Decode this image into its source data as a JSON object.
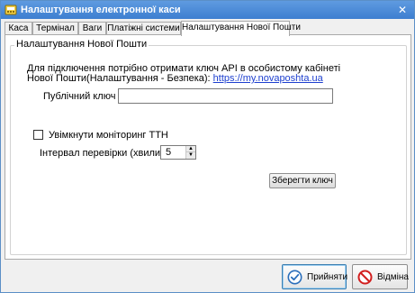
{
  "window": {
    "title": "Налаштування електронної каси",
    "close_glyph": "✕"
  },
  "tabs": [
    {
      "label": "Каса"
    },
    {
      "label": "Термінал"
    },
    {
      "label": "Ваги"
    },
    {
      "label": "Платіжні системи"
    },
    {
      "label": "Налаштування Нової Пошти"
    }
  ],
  "active_tab": "Налаштування Нової Пошти",
  "group": {
    "title": "Налаштування Нової Пошти",
    "info_line1": "Для підключення  потрібно отримати ключ API в особистому кабінеті",
    "info_line2_prefix": "Нової Пошти(Налаштування - Безпека): ",
    "info_link": "https://my.novaposhta.ua",
    "key_label": "Публічний ключ :",
    "key_value": "",
    "monitoring_label": "Увімкнути моніторинг ТТН",
    "monitoring_checked": false,
    "interval_label": "Інтервал перевірки (хвилин):",
    "interval_value": "5",
    "save_key_label": "Зберегти ключ"
  },
  "buttons": {
    "accept_label": "Прийняти",
    "cancel_label": "Відміна"
  },
  "colors": {
    "titlebar": "#3d7ed0",
    "accept_icon": "#2a6ebb",
    "cancel_icon": "#d21f1f",
    "link": "#1d3fcf"
  },
  "icons": {
    "app": "app-icon",
    "close": "close-icon",
    "accept": "check-circle-icon",
    "cancel": "prohibit-circle-icon",
    "stepper_up": "arrow-up-icon",
    "stepper_down": "arrow-down-icon"
  }
}
